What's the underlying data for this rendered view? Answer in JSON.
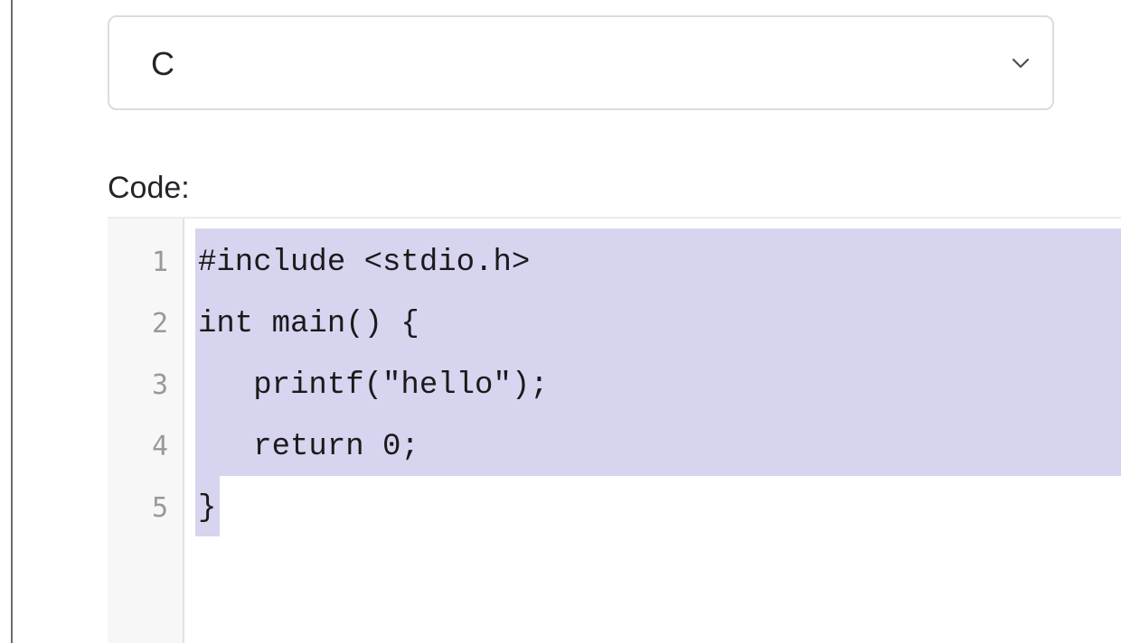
{
  "language_select": {
    "selected": "C",
    "chevron_icon": "chevron-down-icon"
  },
  "code_label": "Code:",
  "editor": {
    "lines": [
      {
        "number": "1",
        "text": "#include <stdio.h>"
      },
      {
        "number": "2",
        "text": "int main() {"
      },
      {
        "number": "3",
        "text": "   printf(\"hello\");"
      },
      {
        "number": "4",
        "text": "   return 0;"
      },
      {
        "number": "5",
        "text": "}"
      }
    ],
    "selection_color": "#d7d4f0"
  }
}
